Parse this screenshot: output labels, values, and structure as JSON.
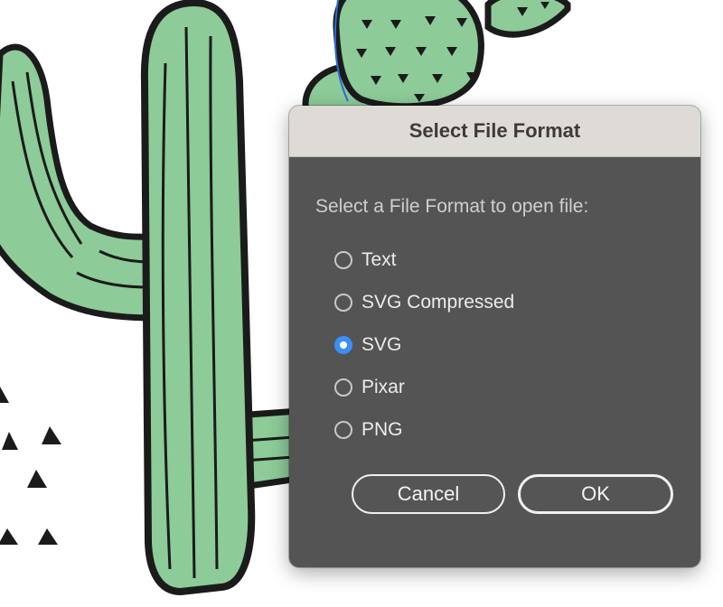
{
  "dialog": {
    "title": "Select File Format",
    "prompt": "Select a File Format to open file:",
    "options": [
      {
        "label": "Text",
        "selected": false
      },
      {
        "label": "SVG Compressed",
        "selected": false
      },
      {
        "label": "SVG",
        "selected": true
      },
      {
        "label": "Pixar",
        "selected": false
      },
      {
        "label": "PNG",
        "selected": false
      }
    ],
    "cancel_label": "Cancel",
    "ok_label": "OK"
  },
  "colors": {
    "cactus_green": "#8dcb98",
    "outline": "#1b1b1b",
    "dialog_bg": "#545454",
    "titlebar_bg": "#dedad5",
    "radio_accent": "#3d8ef7",
    "selection_path": "#2c6bd9"
  }
}
